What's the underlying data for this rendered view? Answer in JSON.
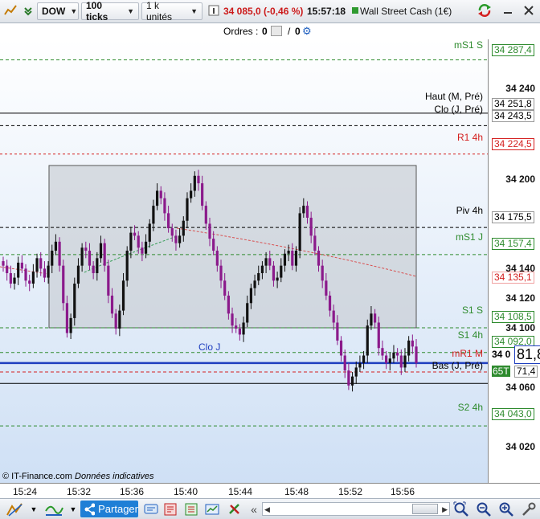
{
  "toolbar": {
    "symbol": "DOW",
    "period": "100 ticks",
    "units": "1 k unités",
    "price_change": "34 085,0 (-0,46 %)",
    "time": "15:57:18",
    "instrument": "Wall Street Cash (1€)"
  },
  "orders": {
    "label": "Ordres :",
    "count1": "0",
    "sep": "/",
    "count2": "0"
  },
  "footer": {
    "copyright": "© IT-Finance.com",
    "note": "Données indicatives"
  },
  "yaxis": {
    "ticks": [
      "34 240",
      "34 200",
      "34 140",
      "34 120",
      "34 100",
      "34 060",
      "34 020"
    ],
    "tags": {
      "ms1s": "34 287,4",
      "haut": "34 251,8",
      "clo_j": "34 243,5",
      "r1_4h": "34 224,5",
      "piv": "34 175,5",
      "ms1_j": "34 157,4",
      "red": "34 135,1",
      "s1s": "34 108,5",
      "s1_4h": "34 092,0",
      "cur_prefix": "34 0",
      "cur_big": "81,8",
      "bas_prefix": "65T",
      "bas": "71,4",
      "s2_4h": "34 043,0"
    }
  },
  "levels": {
    "ms1s": "mS1 S",
    "haut": "Haut (M, Pré)",
    "clo_j_pre": "Clo (J, Pré)",
    "r1_4h": "R1 4h",
    "piv": "Piv 4h",
    "ms1_j": "mS1 J",
    "s1s": "S1 S",
    "s1_4h": "S1 4h",
    "clo_j": "Clo J",
    "mr1_m": "mR1 M",
    "bas": "Bas (J, Pré)",
    "s2_4h": "S2 4h"
  },
  "xaxis": [
    "15:24",
    "15:32",
    "15:36",
    "15:40",
    "15:44",
    "15:48",
    "15:52",
    "15:56"
  ],
  "bottom": {
    "share": "Partager"
  },
  "colors": {
    "bull": "#111111",
    "bear": "#8b1a8b",
    "level_black": "#000000",
    "level_green": "#2e8b2e",
    "level_red": "#d42020",
    "current": "#1f3fbf"
  },
  "chart_data": {
    "type": "candlestick",
    "title": "",
    "ylim": [
      34005,
      34300
    ],
    "x_ticks": [
      "15:24",
      "15:32",
      "15:36",
      "15:40",
      "15:44",
      "15:48",
      "15:52",
      "15:56"
    ],
    "close": [
      34150,
      34145,
      34138,
      34142,
      34152,
      34148,
      34140,
      34138,
      34146,
      34155,
      34148,
      34142,
      34150,
      34160,
      34166,
      34150,
      34125,
      34105,
      34115,
      34138,
      34150,
      34162,
      34160,
      34150,
      34145,
      34155,
      34165,
      34150,
      34130,
      34118,
      34108,
      34120,
      34140,
      34160,
      34172,
      34170,
      34162,
      34158,
      34166,
      34178,
      34190,
      34200,
      34195,
      34185,
      34175,
      34170,
      34165,
      34170,
      34180,
      34195,
      34200,
      34210,
      34205,
      34190,
      34178,
      34168,
      34160,
      34150,
      34140,
      34130,
      34118,
      34110,
      34108,
      34104,
      34112,
      34125,
      34135,
      34140,
      34145,
      34150,
      34155,
      34150,
      34140,
      34142,
      34150,
      34158,
      34160,
      34150,
      34160,
      34185,
      34190,
      34182,
      34170,
      34160,
      34150,
      34140,
      34130,
      34120,
      34112,
      34100,
      34090,
      34080,
      34070,
      34076,
      34082,
      34085,
      34090,
      34110,
      34118,
      34112,
      34095,
      34090,
      34085,
      34088,
      34092,
      34090,
      34082,
      34090,
      34100,
      34096,
      34085
    ]
  }
}
